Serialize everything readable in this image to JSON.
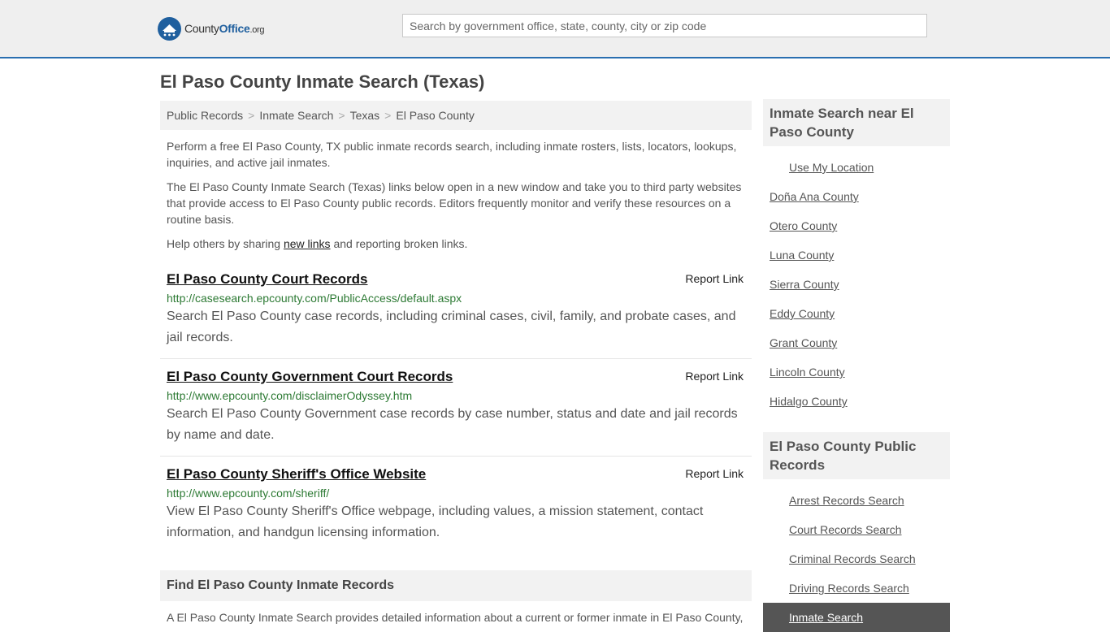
{
  "header": {
    "logo": {
      "county": "County",
      "office": "Office",
      "tld": ".org"
    },
    "search_placeholder": "Search by government office, state, county, city or zip code"
  },
  "page_title": "El Paso County Inmate Search (Texas)",
  "breadcrumb": [
    "Public Records",
    "Inmate Search",
    "Texas",
    "El Paso County"
  ],
  "intro": {
    "p1": "Perform a free El Paso County, TX public inmate records search, including inmate rosters, lists, locators, lookups, inquiries, and active jail inmates.",
    "p2": "The El Paso County Inmate Search (Texas) links below open in a new window and take you to third party websites that provide access to El Paso County public records. Editors frequently monitor and verify these resources on a routine basis.",
    "p3_before": "Help others by sharing ",
    "p3_link": "new links",
    "p3_after": " and reporting broken links."
  },
  "report_label": "Report Link",
  "results": [
    {
      "title": "El Paso County Court Records",
      "url": "http://casesearch.epcounty.com/PublicAccess/default.aspx",
      "desc": "Search El Paso County case records, including criminal cases, civil, family, and probate cases, and jail records."
    },
    {
      "title": "El Paso County Government Court Records",
      "url": "http://www.epcounty.com/disclaimerOdyssey.htm",
      "desc": "Search El Paso County Government case records by case number, status and date and jail records by name and date."
    },
    {
      "title": "El Paso County Sheriff's Office Website",
      "url": "http://www.epcounty.com/sheriff/",
      "desc": "View El Paso County Sheriff's Office webpage, including values, a mission statement, contact information, and handgun licensing information."
    }
  ],
  "find_section": {
    "heading": "Find El Paso County Inmate Records",
    "text": "A El Paso County Inmate Search provides detailed information about a current or former inmate in El Paso County,"
  },
  "sidebar": {
    "near_heading": "Inmate Search near El Paso County",
    "use_location": "Use My Location",
    "nearby": [
      "Doña Ana County",
      "Otero County",
      "Luna County",
      "Sierra County",
      "Eddy County",
      "Grant County",
      "Lincoln County",
      "Hidalgo County"
    ],
    "records_heading": "El Paso County Public Records",
    "records": [
      "Arrest Records Search",
      "Court Records Search",
      "Criminal Records Search",
      "Driving Records Search",
      "Inmate Search"
    ]
  },
  "colors": {
    "accent": "#2a6fb0",
    "url_green": "#2d7a34",
    "active_bg": "#555555"
  }
}
